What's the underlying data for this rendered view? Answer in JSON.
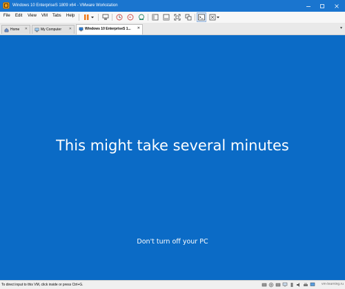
{
  "window": {
    "title": "Windows 10 EnterpriseS 1809 x64 - VMware Workstation",
    "colors": {
      "titlebar": "#1a75cf",
      "vm_background": "#0b6bc6"
    }
  },
  "menu": {
    "file": "File",
    "edit": "Edit",
    "view": "View",
    "vm": "VM",
    "tabs": "Tabs",
    "help": "Help"
  },
  "tabs": [
    {
      "label": "Home",
      "icon": "home-icon"
    },
    {
      "label": "My Computer",
      "icon": "computer-icon"
    },
    {
      "label": "Windows 10 EnterpriseS 1...",
      "icon": "vm-icon"
    }
  ],
  "vm_screen": {
    "message": "This might take several minutes",
    "sub_message": "Don't turn off your PC"
  },
  "status": {
    "text": "To direct input to this VM, click inside or press Ctrl+G.",
    "watermark": "vm-learning.ru"
  }
}
